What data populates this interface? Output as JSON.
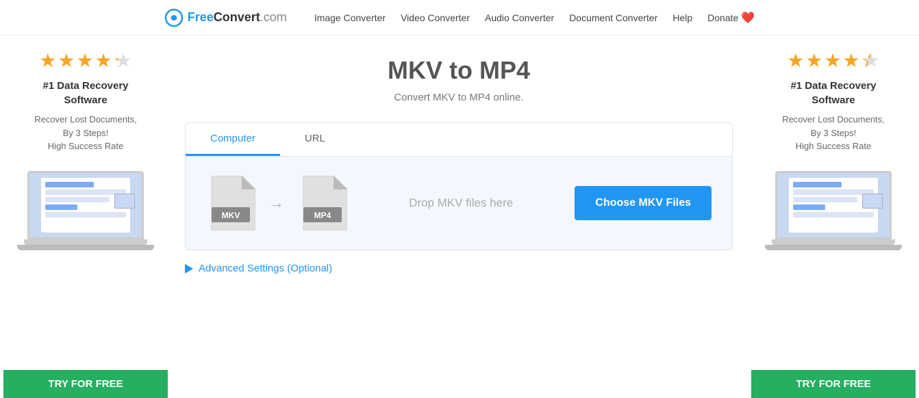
{
  "header": {
    "logo": {
      "free": "Free",
      "convert": "Convert",
      "domain": ".com"
    },
    "nav": [
      {
        "label": "Image Converter",
        "id": "image-converter"
      },
      {
        "label": "Video Converter",
        "id": "video-converter"
      },
      {
        "label": "Audio Converter",
        "id": "audio-converter"
      },
      {
        "label": "Document Converter",
        "id": "document-converter"
      },
      {
        "label": "Help",
        "id": "help"
      },
      {
        "label": "Donate",
        "id": "donate"
      }
    ]
  },
  "main": {
    "page_title": "MKV to MP4",
    "page_subtitle": "Convert MKV to MP4 online.",
    "tabs": [
      {
        "label": "Computer",
        "active": true
      },
      {
        "label": "URL",
        "active": false
      }
    ],
    "source_format": "MKV",
    "target_format": "MP4",
    "drop_text": "Drop MKV files here",
    "choose_button": "Choose MKV Files",
    "advanced_settings": "Advanced Settings (Optional)"
  },
  "ad": {
    "stars": "★★★★½",
    "title": "#1 Data Recovery Software",
    "lines": [
      "Recover Lost Documents,",
      "By 3 Steps!",
      "High Success Rate"
    ],
    "try_button": "TRY FOR FREE"
  }
}
